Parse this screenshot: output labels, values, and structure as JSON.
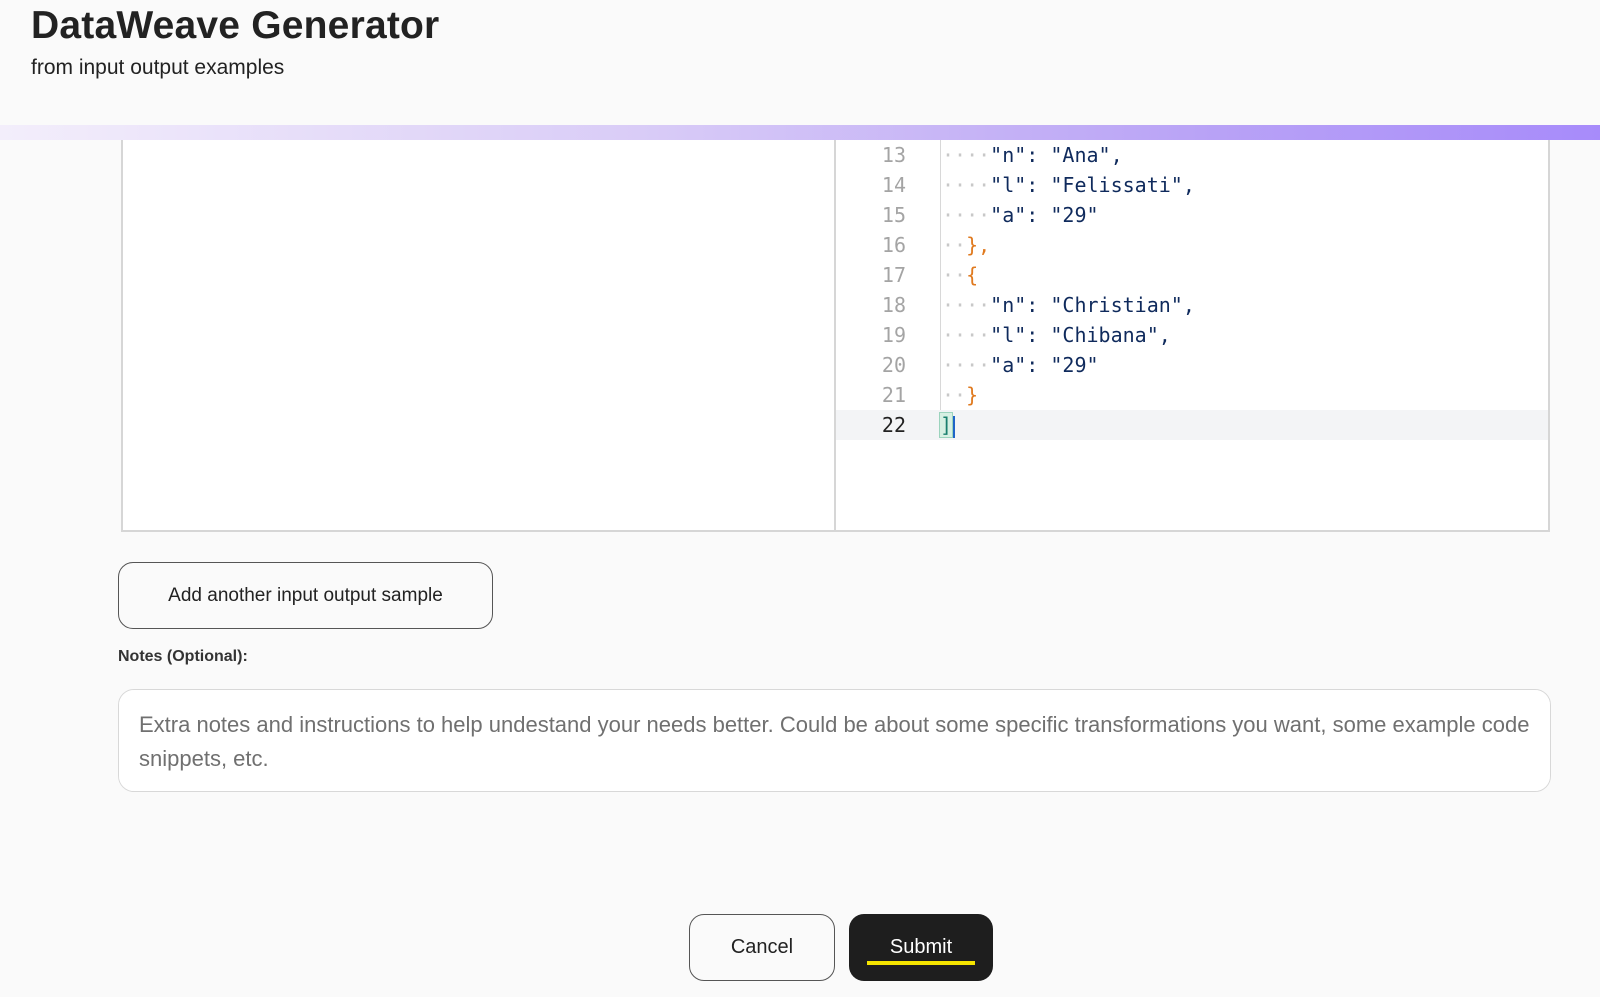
{
  "header": {
    "title": "DataWeave Generator",
    "subtitle": "from input output examples"
  },
  "output_editor": {
    "lines": [
      {
        "num": "13",
        "dots": "····",
        "text": "\"n\": \"Ana\","
      },
      {
        "num": "14",
        "dots": "····",
        "text": "\"l\": \"Felissati\","
      },
      {
        "num": "15",
        "dots": "····",
        "text": "\"a\": \"29\""
      },
      {
        "num": "16",
        "dots": "··",
        "text": "},"
      },
      {
        "num": "17",
        "dots": "··",
        "text": "{"
      },
      {
        "num": "18",
        "dots": "····",
        "text": "\"n\": \"Christian\","
      },
      {
        "num": "19",
        "dots": "····",
        "text": "\"l\": \"Chibana\","
      },
      {
        "num": "20",
        "dots": "····",
        "text": "\"a\": \"29\""
      },
      {
        "num": "21",
        "dots": "··",
        "text": "}"
      },
      {
        "num": "22",
        "dots": "",
        "text": "]"
      }
    ],
    "active_line": "22"
  },
  "actions": {
    "add_sample_label": "Add another input output sample",
    "cancel_label": "Cancel",
    "submit_label": "Submit"
  },
  "notes": {
    "label": "Notes (Optional):",
    "value": "",
    "placeholder": "Extra notes and instructions to help undestand your needs better. Could be about some specific transformations you want, some example code snippets, etc."
  },
  "colors": {
    "accent": "#a78bfa",
    "submit_bg": "#1e1e1e",
    "submit_underline": "#f5e400",
    "brace": "#e07a1f",
    "string": "#0f2a5c"
  }
}
